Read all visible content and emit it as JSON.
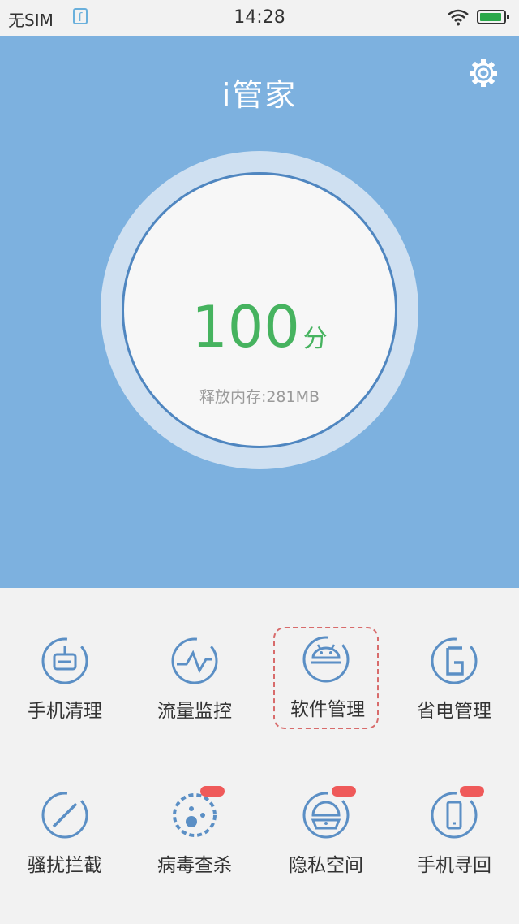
{
  "status_bar": {
    "carrier": "无SIM",
    "notification_icon": "f",
    "time": "14:28"
  },
  "header": {
    "title": "i管家",
    "settings_icon": "gear-icon"
  },
  "score": {
    "value": "100",
    "unit": "分",
    "memory_text": "释放内存:281MB"
  },
  "tools": [
    {
      "label": "手机清理",
      "icon": "phone-clean-icon",
      "selected": false,
      "badge": false
    },
    {
      "label": "流量监控",
      "icon": "traffic-monitor-icon",
      "selected": false,
      "badge": false
    },
    {
      "label": "软件管理",
      "icon": "android-icon",
      "selected": true,
      "badge": false
    },
    {
      "label": "省电管理",
      "icon": "battery-save-icon",
      "selected": false,
      "badge": false
    },
    {
      "label": "骚扰拦截",
      "icon": "block-icon",
      "selected": false,
      "badge": false
    },
    {
      "label": "病毒查杀",
      "icon": "virus-icon",
      "selected": false,
      "badge": true
    },
    {
      "label": "隐私空间",
      "icon": "privacy-lock-icon",
      "selected": false,
      "badge": true
    },
    {
      "label": "手机寻回",
      "icon": "phone-find-icon",
      "selected": false,
      "badge": true
    }
  ],
  "colors": {
    "hero": "#7db1df",
    "accent_green": "#46b35f",
    "icon_blue": "#5b8fc5",
    "badge_red": "#ef5a5a"
  }
}
